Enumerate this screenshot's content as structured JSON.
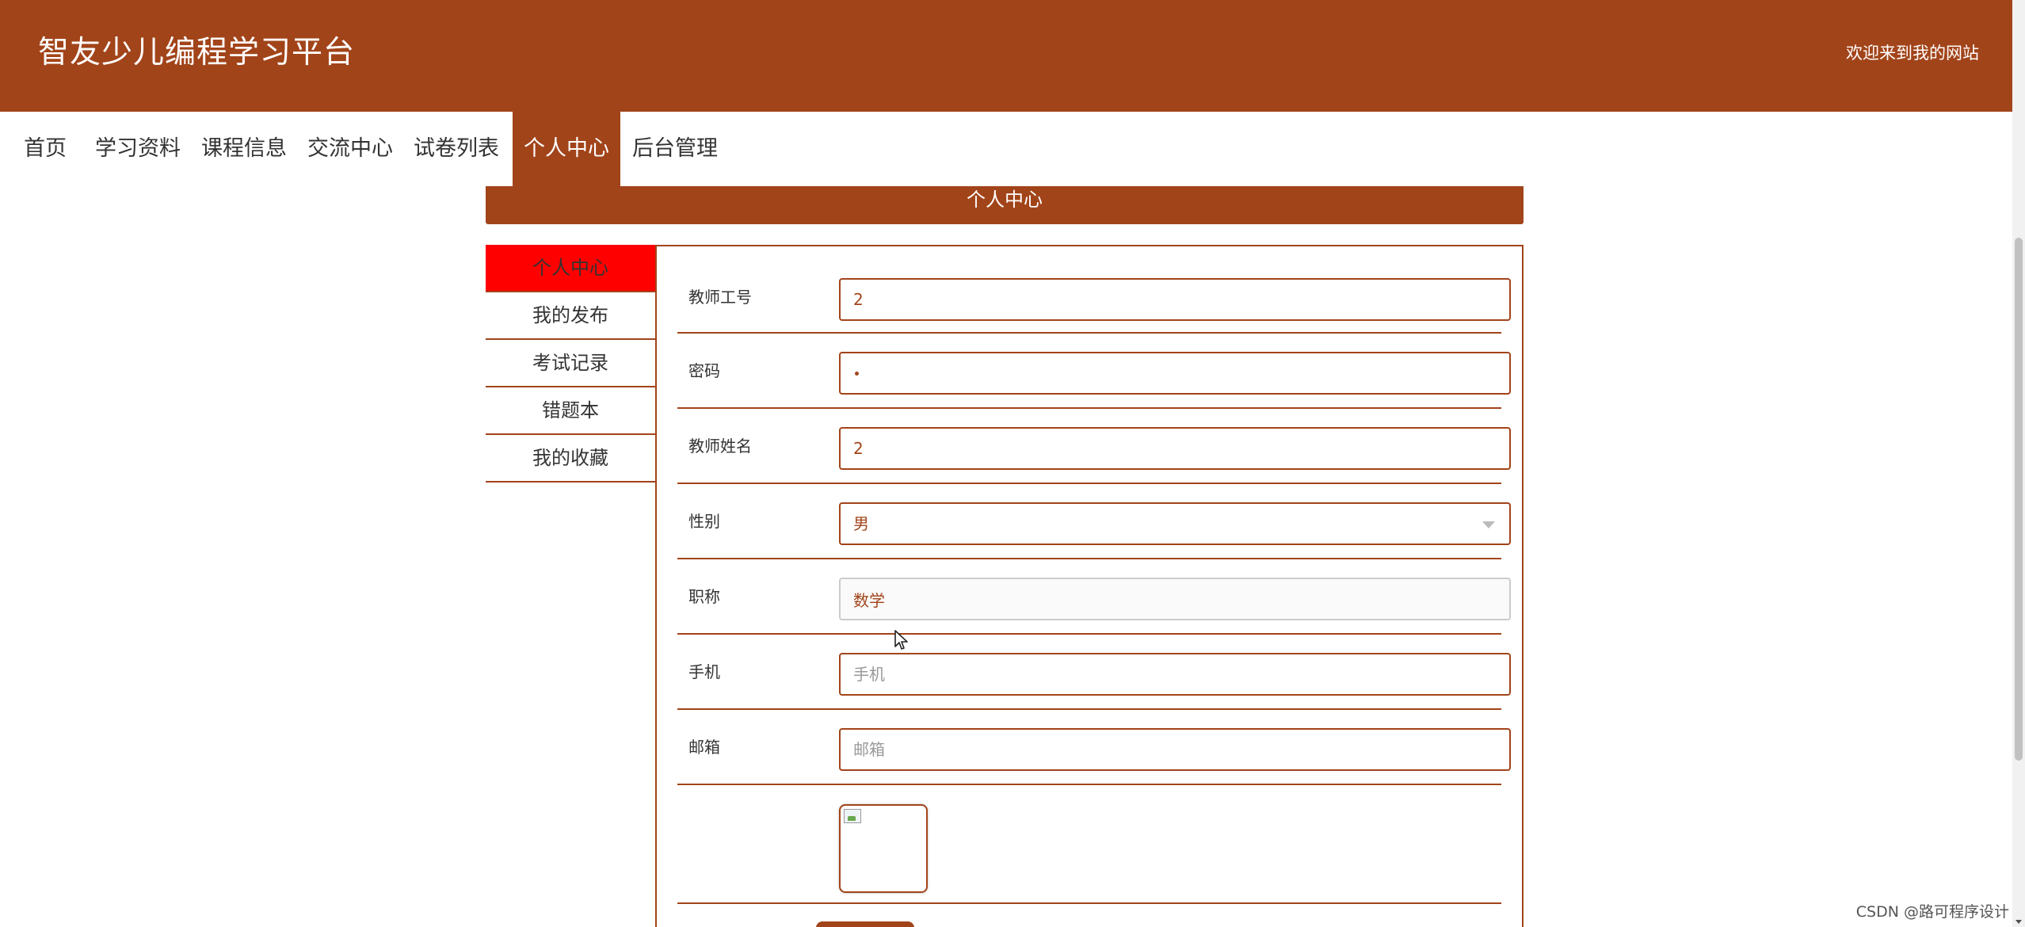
{
  "header": {
    "site_title": "智友少儿编程学习平台",
    "welcome": "欢迎来到我的网站"
  },
  "nav": {
    "items": [
      {
        "label": "首页"
      },
      {
        "label": "学习资料"
      },
      {
        "label": "课程信息"
      },
      {
        "label": "交流中心"
      },
      {
        "label": "试卷列表"
      },
      {
        "label": "个人中心",
        "active": true
      },
      {
        "label": "后台管理"
      }
    ]
  },
  "banner": {
    "title": "个人中心"
  },
  "side_menu": {
    "items": [
      {
        "label": "个人中心",
        "active": true
      },
      {
        "label": "我的发布"
      },
      {
        "label": "考试记录"
      },
      {
        "label": "错题本"
      },
      {
        "label": "我的收藏"
      }
    ]
  },
  "form": {
    "teacher_id": {
      "label": "教师工号",
      "value": "2"
    },
    "password": {
      "label": "密码",
      "value": "•"
    },
    "teacher_name": {
      "label": "教师姓名",
      "value": "2"
    },
    "gender": {
      "label": "性别",
      "value": "男"
    },
    "title": {
      "label": "职称",
      "value": "数学"
    },
    "phone": {
      "label": "手机",
      "value": "",
      "placeholder": "手机"
    },
    "email": {
      "label": "邮箱",
      "value": "",
      "placeholder": "邮箱"
    }
  },
  "colors": {
    "brand": "#a2441a",
    "active_side": "#ff0000"
  },
  "watermark": "CSDN @路可程序设计"
}
